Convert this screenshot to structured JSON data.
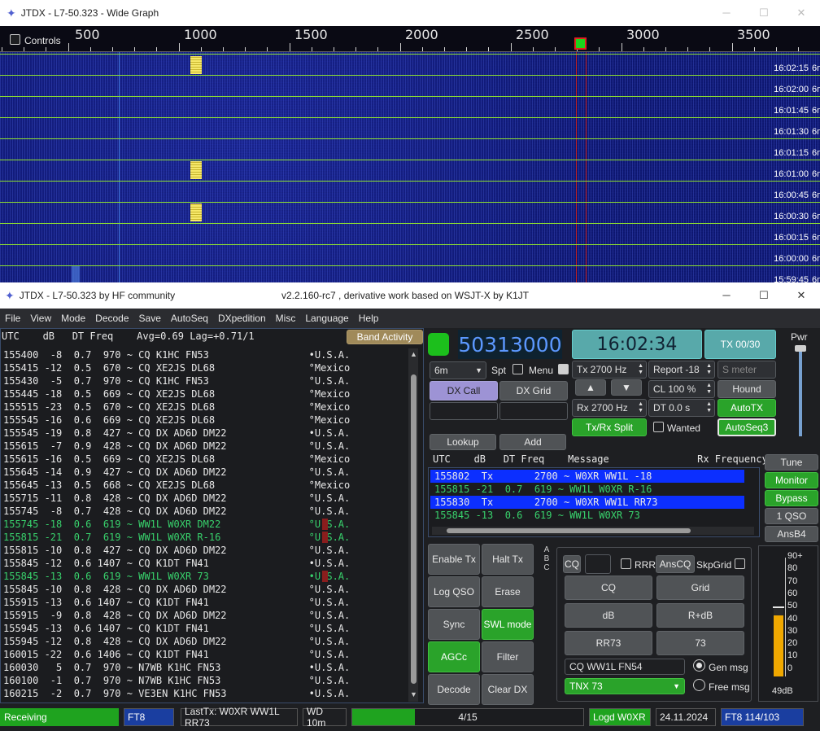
{
  "wide_graph": {
    "title": "JTDX - L7-50.323 - Wide Graph",
    "controls_label": "Controls",
    "scale": [
      "500",
      "1000",
      "1500",
      "2000",
      "2500",
      "3000",
      "3500"
    ],
    "times": [
      "16:02:15",
      "16:02:00",
      "16:01:45",
      "16:01:30",
      "16:01:15",
      "16:01:00",
      "16:00:45",
      "16:00:30",
      "16:00:15",
      "16:00:00",
      "15:59:45"
    ],
    "band": "6m"
  },
  "main": {
    "title": "JTDX - L7-50.323  by HF community",
    "subtitle": "v2.2.160-rc7 , derivative work based on WSJT-X by K1JT"
  },
  "menu": [
    "File",
    "View",
    "Mode",
    "Decode",
    "Save",
    "AutoSeq",
    "DXpedition",
    "Misc",
    "Language",
    "Help"
  ],
  "band_activity": {
    "header": "UTC    dB   DT Freq    Avg=0.69 Lag=+0.71/1",
    "button": "Band Activity",
    "lines": [
      {
        "text": "155400  -8  0.7  970 ~ CQ K1HC FN53                 •U.S.A.",
        "color": "white"
      },
      {
        "text": "155415 -12  0.5  670 ~ CQ XE2JS DL68                °Mexico",
        "color": "white"
      },
      {
        "text": "155430  -5  0.7  970 ~ CQ K1HC FN53                 °U.S.A.",
        "color": "white"
      },
      {
        "text": "155445 -18  0.5  669 ~ CQ XE2JS DL68                °Mexico",
        "color": "white"
      },
      {
        "text": "155515 -23  0.5  670 ~ CQ XE2JS DL68                °Mexico",
        "color": "white"
      },
      {
        "text": "155545 -16  0.6  669 ~ CQ XE2JS DL68                °Mexico",
        "color": "white"
      },
      {
        "text": "155545 -19  0.8  427 ~ CQ DX AD6D DM22              •U.S.A.",
        "color": "white"
      },
      {
        "text": "155615  -7  0.9  428 ~ CQ DX AD6D DM22              °U.S.A.",
        "color": "white"
      },
      {
        "text": "155615 -16  0.5  669 ~ CQ XE2JS DL68                °Mexico",
        "color": "white"
      },
      {
        "text": "155645 -14  0.9  427 ~ CQ DX AD6D DM22              °U.S.A.",
        "color": "white"
      },
      {
        "text": "155645 -13  0.5  668 ~ CQ XE2JS DL68                °Mexico",
        "color": "white"
      },
      {
        "text": "155715 -11  0.8  428 ~ CQ DX AD6D DM22              °U.S.A.",
        "color": "white"
      },
      {
        "text": "155745  -8  0.7  428 ~ CQ DX AD6D DM22              °U.S.A.",
        "color": "white"
      },
      {
        "text": "155745 -18  0.6  619 ~ WW1L W0XR DM22               °U.S.A.",
        "color": "green",
        "flag": true
      },
      {
        "text": "155815 -21  0.7  619 ~ WW1L W0XR R-16               °U.S.A.",
        "color": "green",
        "flag": true
      },
      {
        "text": "155815 -10  0.8  427 ~ CQ DX AD6D DM22              °U.S.A.",
        "color": "white"
      },
      {
        "text": "155845 -12  0.6 1407 ~ CQ K1DT FN41                 •U.S.A.",
        "color": "white"
      },
      {
        "text": "155845 -13  0.6  619 ~ WW1L W0XR 73                 •U.S.A.",
        "color": "green",
        "flag": true
      },
      {
        "text": "155845 -10  0.8  428 ~ CQ DX AD6D DM22              °U.S.A.",
        "color": "white"
      },
      {
        "text": "155915 -13  0.6 1407 ~ CQ K1DT FN41                 °U.S.A.",
        "color": "white"
      },
      {
        "text": "155915  -9  0.8  428 ~ CQ DX AD6D DM22              °U.S.A.",
        "color": "white"
      },
      {
        "text": "155945 -13  0.6 1407 ~ CQ K1DT FN41                 °U.S.A.",
        "color": "white"
      },
      {
        "text": "155945 -12  0.8  428 ~ CQ DX AD6D DM22              °U.S.A.",
        "color": "white"
      },
      {
        "text": "160015 -22  0.6 1406 ~ CQ K1DT FN41                 °U.S.A.",
        "color": "white"
      },
      {
        "text": "160030   5  0.7  970 ~ N7WB K1HC FN53               •U.S.A.",
        "color": "white"
      },
      {
        "text": "160100  -1  0.7  970 ~ N7WB K1HC FN53               °U.S.A.",
        "color": "white"
      },
      {
        "text": "160215  -2  0.7  970 ~ VE3EN K1HC FN53              •U.S.A.",
        "color": "white"
      }
    ]
  },
  "controls": {
    "dial_freq": "50313000",
    "clock": "16:02:34",
    "tx_counter": "TX 00/30",
    "pwr_label": "Pwr",
    "band": "6m",
    "spt": "Spt",
    "menu": "Menu",
    "dx_call": "DX Call",
    "dx_grid": "DX Grid",
    "tx_hz": "Tx  2700  Hz",
    "rx_hz": "Rx  2700  Hz",
    "report": "Report -18",
    "cl": "CL  100 %",
    "dt": "DT 0.0 s",
    "smeter_placeholder": "S meter",
    "hound": "Hound",
    "autotx": "AutoTX",
    "autoseq3": "AutoSeq3",
    "txrx_split": "Tx/Rx Split",
    "wanted": "Wanted",
    "lookup": "Lookup",
    "add": "Add",
    "up": "▲",
    "down": "▼"
  },
  "rx_window": {
    "header": "UTC    dB   DT Freq    Message               Rx Frequency",
    "lines": [
      {
        "text": "155802  Tx       2700 ~ W0XR WW1L -18",
        "style": "tx"
      },
      {
        "text": "155815 -21  0.7  619 ~ WW1L W0XR R-16",
        "style": "rx"
      },
      {
        "text": "155830  Tx       2700 ~ W0XR WW1L RR73",
        "style": "tx"
      },
      {
        "text": "155845 -13  0.6  619 ~ WW1L W0XR 73",
        "style": "rx"
      }
    ]
  },
  "side_buttons": {
    "tune": "Tune",
    "monitor": "Monitor",
    "bypass": "Bypass",
    "qso1": "1 QSO",
    "ansb4": "AnsB4"
  },
  "bottom_buttons": {
    "enable_tx": "Enable Tx",
    "halt_tx": "Halt Tx",
    "log_qso": "Log QSO",
    "erase": "Erase",
    "sync": "Sync",
    "swl_mode": "SWL mode",
    "agcc": "AGCc",
    "filter": "Filter",
    "decode": "Decode",
    "clear_dx": "Clear DX"
  },
  "msg_panel": {
    "cq": "CQ",
    "rrr": "RRR",
    "anscq": "AnsCQ",
    "skpgrid": "SkpGrid",
    "b_cq": "CQ",
    "b_grid": "Grid",
    "b_db": "dB",
    "b_rdb": "R+dB",
    "b_rr73": "RR73",
    "b_73": "73",
    "gen_text": "CQ WW1L FN54",
    "gen_msg": "Gen msg",
    "free_text": "TNX 73",
    "free_msg": "Free msg"
  },
  "meter": {
    "scale": [
      "90+",
      "80",
      "70",
      "60",
      "50",
      "40",
      "30",
      "20",
      "10",
      "0"
    ],
    "readout": "49dB",
    "level_db": 49
  },
  "status_bar": {
    "state": "Receiving",
    "mode": "FT8",
    "last_tx": "LastTx: W0XR WW1L RR73",
    "wd": "WD 10m",
    "progress": "4/15",
    "progress_fraction": 0.27,
    "logged": "Logd W0XR",
    "date": "24.11.2024",
    "mode_count": "FT8  114/103"
  },
  "colors": {
    "green": "#2aa32a",
    "teal": "#58a9aa",
    "tx_highlight": "#0c2fff",
    "rx_green": "#38d26c",
    "red_marker": "#e02020"
  }
}
